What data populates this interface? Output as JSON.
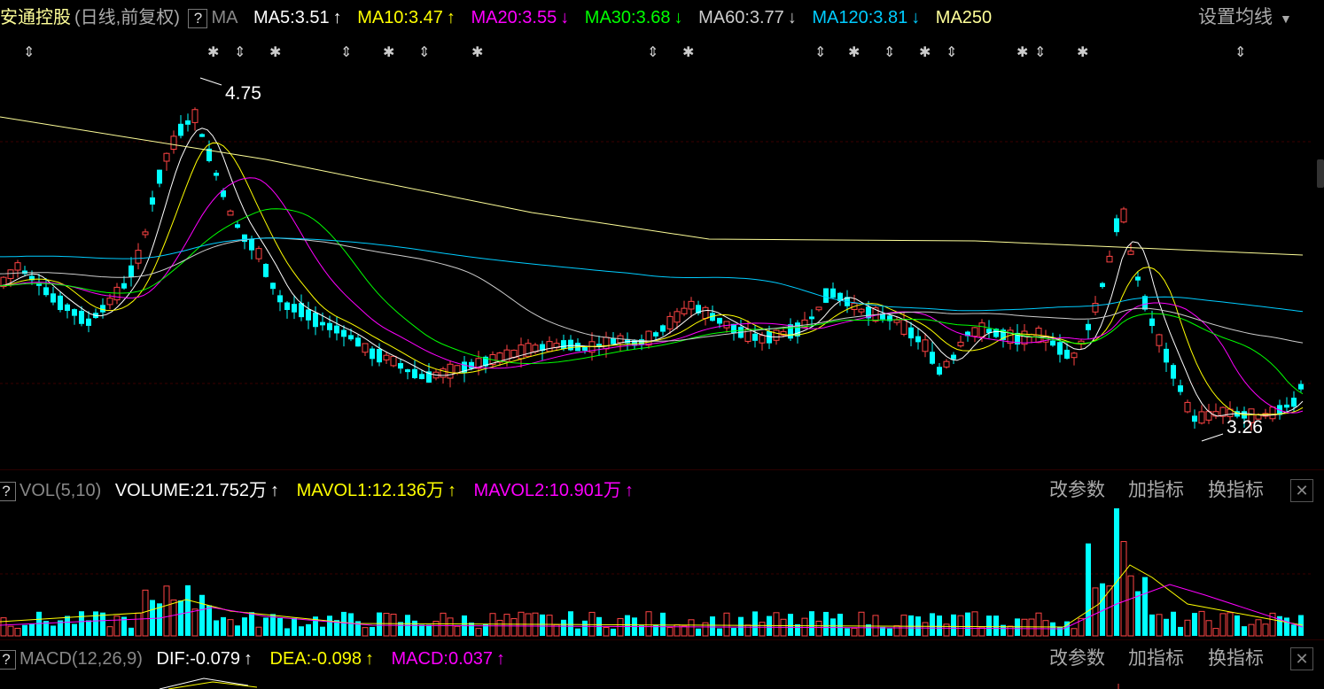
{
  "main": {
    "stock_name": "安通控股",
    "period": "(日线,前复权)",
    "help": "?",
    "indicator": "MA",
    "mas": [
      {
        "label": "MA5:3.51",
        "arrow": "↑",
        "color": "#ffffff"
      },
      {
        "label": "MA10:3.47",
        "arrow": "↑",
        "color": "#ffff00"
      },
      {
        "label": "MA20:3.55",
        "arrow": "↓",
        "color": "#ff00ff"
      },
      {
        "label": "MA30:3.68",
        "arrow": "↓",
        "color": "#00ff00"
      },
      {
        "label": "MA60:3.77",
        "arrow": "↓",
        "color": "#cccccc"
      },
      {
        "label": "MA120:3.81",
        "arrow": "↓",
        "color": "#00ccff"
      },
      {
        "label": "MA250",
        "arrow": "",
        "color": "#ffff99"
      }
    ],
    "settings": "设置均线",
    "high_label": "4.75",
    "low_label": "3.26"
  },
  "vol": {
    "help": "?",
    "title": "VOL(5,10)",
    "volume": "VOLUME:21.752万",
    "volume_arrow": "↑",
    "mavol1": "MAVOL1:12.136万",
    "mavol1_arrow": "↑",
    "mavol2": "MAVOL2:10.901万",
    "mavol2_arrow": "↑",
    "btn_params": "改参数",
    "btn_add": "加指标",
    "btn_switch": "换指标",
    "close": "✕"
  },
  "macd": {
    "help": "?",
    "title": "MACD(12,26,9)",
    "dif": "DIF:-0.079",
    "dif_arrow": "↑",
    "dea": "DEA:-0.098",
    "dea_arrow": "↑",
    "macd": "MACD:0.037",
    "macd_arrow": "↑",
    "btn_params": "改参数",
    "btn_add": "加指标",
    "btn_switch": "换指标",
    "close": "✕"
  },
  "colors": {
    "up": "#ff4444",
    "down": "#00ffff",
    "grid": "#3a0000"
  }
}
